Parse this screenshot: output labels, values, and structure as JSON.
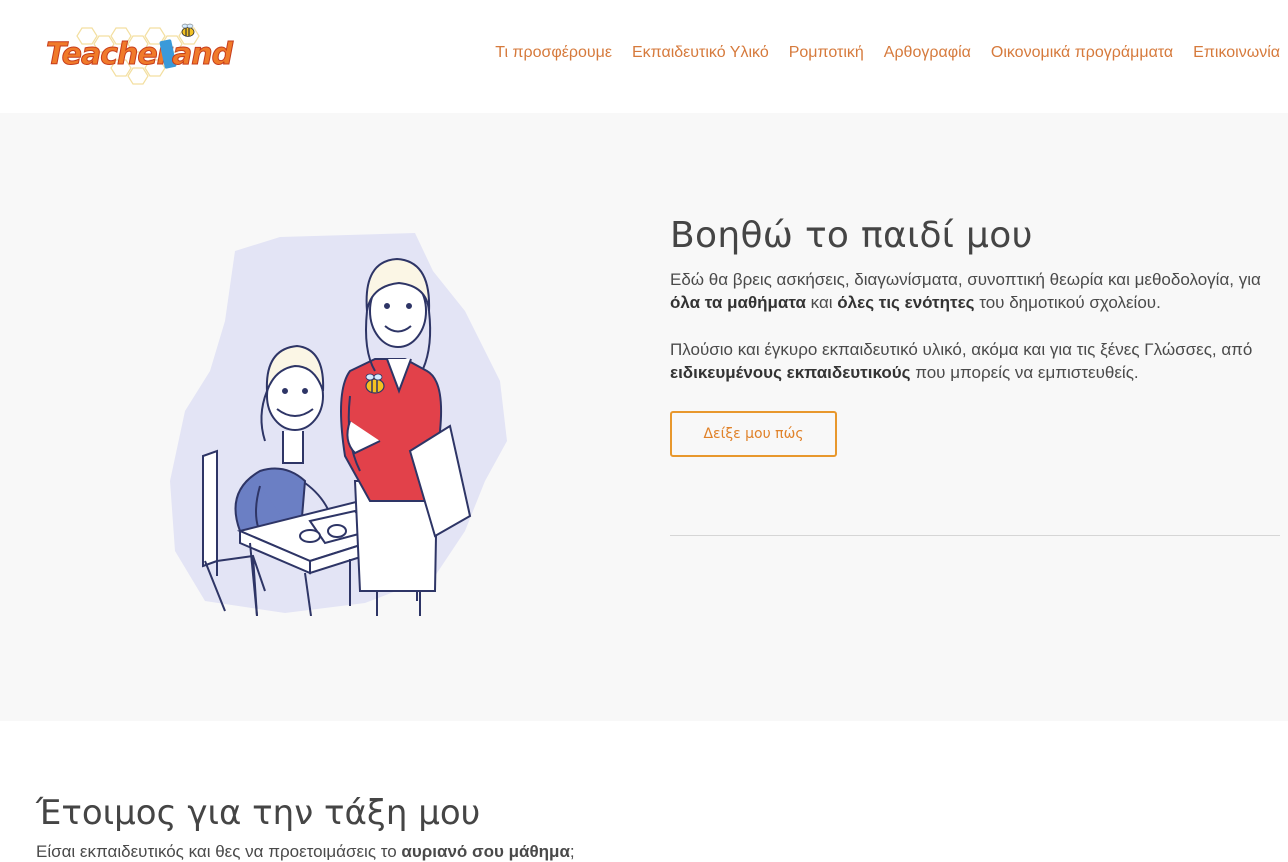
{
  "header": {
    "logo_text": "TeacherLand",
    "nav": [
      {
        "label": "Τι προσφέρουμε"
      },
      {
        "label": "Εκπαιδευτικό Υλικό"
      },
      {
        "label": "Ρομποτική"
      },
      {
        "label": "Αρθογραφία"
      },
      {
        "label": "Οικονομικά προγράμματα"
      },
      {
        "label": "Επικοινωνία"
      }
    ]
  },
  "hero": {
    "title": "Βοηθώ το παιδί μου",
    "para1": {
      "t1": "Εδώ θα βρεις ασκήσεις,  διαγωνίσματα, συνοπτική θεωρία και μεθοδολογία, για ",
      "b1": "όλα τα μαθήματα",
      "t2": " και ",
      "b2": "όλες τις ενότητες",
      "t3": " του δημοτικού σχολείου."
    },
    "para2": {
      "t1": "Πλούσιο και έγκυρο εκπαιδευτικό υλικό, ακόμα και για τις ξένες Γλώσσες, από ",
      "b1": "ειδικευμένους εκπαιδευτικούς",
      "t2": " που μπορείς να εμπιστευθείς."
    },
    "button_label": "Δείξε μου πώς"
  },
  "section2": {
    "title": "Έτοιμος για την τάξη μου",
    "para": {
      "t1": "Είσαι εκπαιδευτικός και θες να προετοιμάσεις το ",
      "b1": "αυριανό σου μάθημα",
      "t2": ";"
    }
  },
  "colors": {
    "accent": "#e8982d",
    "nav": "#d67a3c",
    "hero_bg": "#f8f8f8",
    "sweater_red": "#e2414a",
    "blue_shirt": "#6b7fc4"
  }
}
